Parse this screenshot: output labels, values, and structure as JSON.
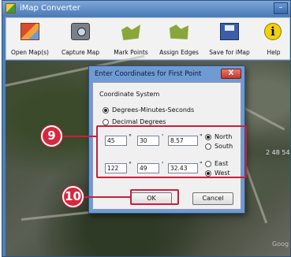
{
  "window": {
    "title": "iMap Converter",
    "minimize": "–"
  },
  "toolbar": {
    "open_maps": "Open Map(s)",
    "capture_map": "Capture Map",
    "mark_points": "Mark Points",
    "assign_edges": "Assign Edges",
    "save_for_imap": "Save for iMap",
    "help": "Help",
    "help_glyph": "i"
  },
  "map": {
    "overlay_text": "2 48 54",
    "bottom_text": "Goog"
  },
  "dialog": {
    "title": "Enter Coordinates for First Point",
    "close": "X",
    "coordinate_system_label": "Coordinate System",
    "options": {
      "dms": "Degrees-Minutes-Seconds",
      "decimal": "Decimal Degrees"
    },
    "latitude": {
      "degrees": "45",
      "minutes": "30",
      "seconds": "8.57",
      "north": "North",
      "south": "South"
    },
    "longitude": {
      "degrees": "122",
      "minutes": "49",
      "seconds": "32.43",
      "east": "East",
      "west": "West"
    },
    "units": {
      "degree": "°",
      "minute": "'",
      "second": "\""
    },
    "ok": "OK",
    "cancel": "Cancel"
  },
  "callouts": {
    "fields": "9",
    "ok_button": "10"
  },
  "colors": {
    "callout": "#c8203a",
    "titlebar": "#4a7ab8"
  }
}
